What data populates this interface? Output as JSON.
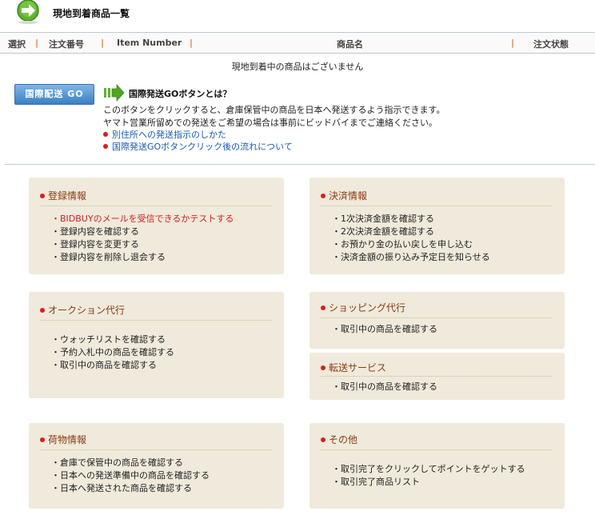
{
  "header": {
    "title": "現地到着商品一覧"
  },
  "table": {
    "columns": [
      "選択",
      "注文番号",
      "Item Number",
      "商品名",
      "注文状態"
    ],
    "separator": "|",
    "empty_message": "現地到着中の商品はございません"
  },
  "go": {
    "button_label": "国際配送 GO",
    "title": "国際発送GOボタンとは？",
    "lines": [
      "このボタンをクリックすると、倉庫保管中の商品を日本へ発送するよう指示できます。",
      "ヤマト営業所留めでの発送をご希望の場合は事前にビッドバイまでご連絡ください。"
    ],
    "links": [
      "別住所への発送指示のしかた",
      "国際発送GOボタンクリック後の流れについて"
    ]
  },
  "panels": {
    "registration": {
      "title": "登録情報",
      "items": [
        "・BIDBUYのメールを受信できるかテストする",
        "・登録内容を確認する",
        "・登録内容を変更する",
        "・登録内容を削除し退会する"
      ]
    },
    "payment": {
      "title": "決済情報",
      "items": [
        "・1次決済金額を確認する",
        "・2次決済金額を確認する",
        "・お預かり金の払い戻しを申し込む",
        "・決済金額の振り込み予定日を知らせる"
      ]
    },
    "auction": {
      "title": "オークション代行",
      "items": [
        "・ウォッチリストを確認する",
        "・予約入札中の商品を確認する",
        "・取引中の商品を確認する"
      ]
    },
    "shopping": {
      "title": "ショッピング代行",
      "items": [
        "・取引中の商品を確認する"
      ]
    },
    "forwarding": {
      "title": "転送サービス",
      "items": [
        "・取引中の商品を確認する"
      ]
    },
    "cargo": {
      "title": "荷物情報",
      "items": [
        "・倉庫で保管中の商品を確認する",
        "・日本への発送準備中の商品を確認する",
        "・日本へ発送された商品を確認する"
      ]
    },
    "other": {
      "title": "その他",
      "items": [
        "・取引完了をクリックしてポイントをゲットする",
        "・取引完了商品リスト"
      ]
    }
  },
  "colors": {
    "accent_link": "#1a5bb5",
    "panel_bg": "#efeadb",
    "panel_title": "#8a3a12",
    "alert_red": "#d12020",
    "separator_orange": "#e07a3a"
  }
}
